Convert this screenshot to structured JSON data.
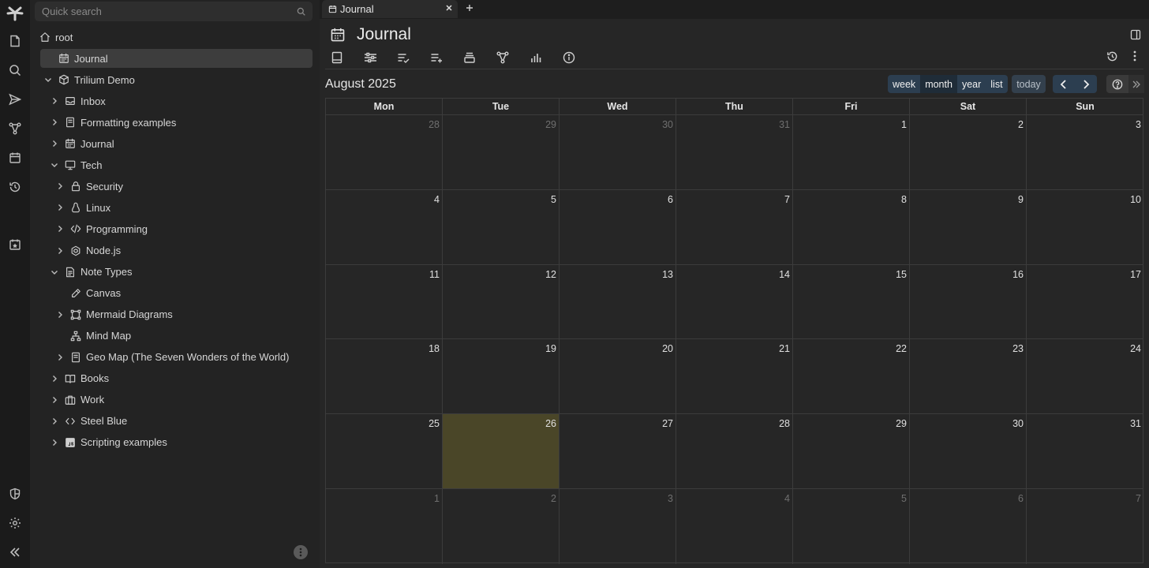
{
  "search": {
    "placeholder": "Quick search"
  },
  "tree": [
    {
      "label": "root",
      "icon": "home-icon",
      "level": 0,
      "chevron": "none"
    },
    {
      "label": "Journal",
      "icon": "calendar-icon",
      "level": 1,
      "chevron": "none",
      "selected": true
    },
    {
      "label": "Trilium Demo",
      "icon": "package-icon",
      "level": 1,
      "chevron": "down"
    },
    {
      "label": "Inbox",
      "icon": "inbox-icon",
      "level": 2,
      "chevron": "right"
    },
    {
      "label": "Formatting examples",
      "icon": "book-icon",
      "level": 2,
      "chevron": "right"
    },
    {
      "label": "Journal",
      "icon": "calendar-icon",
      "level": 2,
      "chevron": "right"
    },
    {
      "label": "Tech",
      "icon": "monitor-icon",
      "level": 2,
      "chevron": "down"
    },
    {
      "label": "Security",
      "icon": "lock-icon",
      "level": 3,
      "chevron": "right"
    },
    {
      "label": "Linux",
      "icon": "tux-icon",
      "level": 3,
      "chevron": "right"
    },
    {
      "label": "Programming",
      "icon": "code-icon",
      "level": 3,
      "chevron": "right"
    },
    {
      "label": "Node.js",
      "icon": "hexagon-icon",
      "level": 3,
      "chevron": "right"
    },
    {
      "label": "Note Types",
      "icon": "file-text-icon",
      "level": 2,
      "chevron": "down"
    },
    {
      "label": "Canvas",
      "icon": "pen-icon",
      "level": 3,
      "chevron": "none"
    },
    {
      "label": "Mermaid Diagrams",
      "icon": "shapes-icon",
      "level": 3,
      "chevron": "right"
    },
    {
      "label": "Mind Map",
      "icon": "sitemap-icon",
      "level": 3,
      "chevron": "none"
    },
    {
      "label": "Geo Map (The Seven Wonders of the World)",
      "icon": "book-icon",
      "level": 3,
      "chevron": "right"
    },
    {
      "label": "Books",
      "icon": "book-open-icon",
      "level": 2,
      "chevron": "right"
    },
    {
      "label": "Work",
      "icon": "briefcase-icon",
      "level": 2,
      "chevron": "right"
    },
    {
      "label": "Steel Blue",
      "icon": "code-brackets-icon",
      "level": 2,
      "chevron": "right"
    },
    {
      "label": "Scripting examples",
      "icon": "js-file-icon",
      "level": 2,
      "chevron": "right"
    }
  ],
  "tab": {
    "label": "Journal"
  },
  "note": {
    "title": "Journal"
  },
  "calendar": {
    "title": "August 2025",
    "views": [
      "week",
      "month",
      "year",
      "list"
    ],
    "active_view": "month",
    "today_label": "today",
    "weekdays": [
      "Mon",
      "Tue",
      "Wed",
      "Thu",
      "Fri",
      "Sat",
      "Sun"
    ],
    "weeks": [
      [
        {
          "d": "28",
          "o": true
        },
        {
          "d": "29",
          "o": true
        },
        {
          "d": "30",
          "o": true
        },
        {
          "d": "31",
          "o": true
        },
        {
          "d": "1"
        },
        {
          "d": "2"
        },
        {
          "d": "3"
        }
      ],
      [
        {
          "d": "4"
        },
        {
          "d": "5"
        },
        {
          "d": "6"
        },
        {
          "d": "7"
        },
        {
          "d": "8"
        },
        {
          "d": "9"
        },
        {
          "d": "10"
        }
      ],
      [
        {
          "d": "11"
        },
        {
          "d": "12"
        },
        {
          "d": "13"
        },
        {
          "d": "14"
        },
        {
          "d": "15"
        },
        {
          "d": "16"
        },
        {
          "d": "17"
        }
      ],
      [
        {
          "d": "18"
        },
        {
          "d": "19"
        },
        {
          "d": "20"
        },
        {
          "d": "21"
        },
        {
          "d": "22"
        },
        {
          "d": "23"
        },
        {
          "d": "24"
        }
      ],
      [
        {
          "d": "25"
        },
        {
          "d": "26",
          "today": true
        },
        {
          "d": "27"
        },
        {
          "d": "28"
        },
        {
          "d": "29"
        },
        {
          "d": "30"
        },
        {
          "d": "31"
        }
      ],
      [
        {
          "d": "1",
          "o": true
        },
        {
          "d": "2",
          "o": true
        },
        {
          "d": "3",
          "o": true
        },
        {
          "d": "4",
          "o": true
        },
        {
          "d": "5",
          "o": true
        },
        {
          "d": "6",
          "o": true
        },
        {
          "d": "7",
          "o": true
        }
      ]
    ],
    "today_color": "#4a4628"
  }
}
